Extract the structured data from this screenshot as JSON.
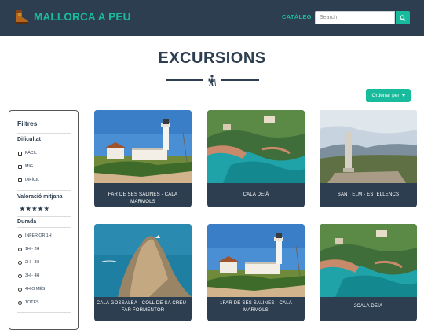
{
  "header": {
    "brand": "MALLORCA A PEU",
    "nav_link": "CATÀLEG",
    "search_placeholder": "Search",
    "colors": {
      "navbar": "#2c3e50",
      "accent": "#18bc9c"
    }
  },
  "page": {
    "title": "EXCURSIONS",
    "sort_label": "Ordenar per"
  },
  "filters": {
    "title": "Filtres",
    "difficulty": {
      "label": "Dificultat",
      "options": [
        "FÀCIL",
        "MIG",
        "DIFÍCIL"
      ]
    },
    "rating": {
      "label": "Valoració mitjana",
      "stars": "★★★★★"
    },
    "duration": {
      "label": "Durada",
      "options": [
        "INFERIOR 1H",
        "1H - 2H",
        "2H - 3H",
        "3H - 4H",
        "4H O MÉS",
        "TOTES"
      ]
    }
  },
  "cards": [
    {
      "name": "FAR DE SES SALINES - CALA MARMOLS",
      "image": "lighthouse"
    },
    {
      "name": "CALA DEIÀ",
      "image": "cove"
    },
    {
      "name": "SANT ELM - ESTELLENCS",
      "image": "monument"
    },
    {
      "name": "CALA GOSSALBA - COLL DE SA CREU - FAR FORMENTOR",
      "image": "peninsula"
    },
    {
      "name": "1FAR DE SES SALINES - CALA MARMOLS",
      "image": "lighthouse"
    },
    {
      "name": "2CALA DEIÀ",
      "image": "cove"
    }
  ]
}
